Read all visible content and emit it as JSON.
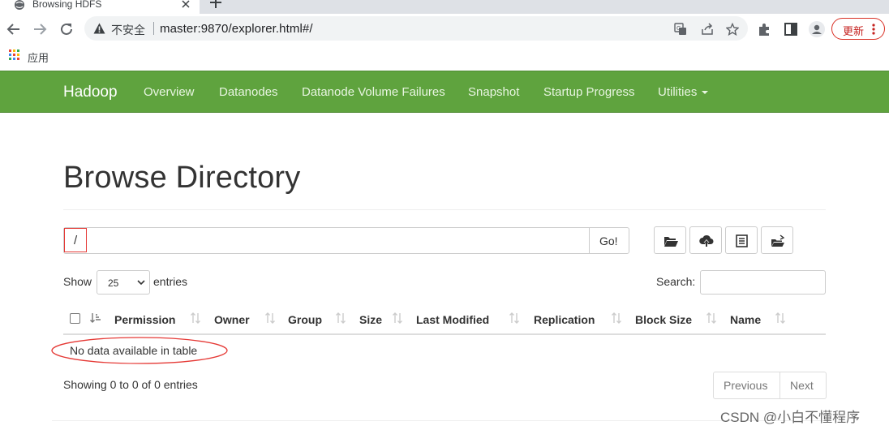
{
  "browser": {
    "tab_title": "Browsing HDFS",
    "insecure_label": "不安全",
    "url": "master:9870/explorer.html#/",
    "update_label": "更新",
    "bookmarks_apps_label": "应用",
    "icons": [
      "back-icon",
      "forward-icon",
      "reload-icon",
      "warning-icon",
      "translate-icon",
      "share-icon",
      "star-icon",
      "extensions-icon",
      "sidebar-icon",
      "profile-icon",
      "more-icon",
      "apps-icon"
    ]
  },
  "navbar": {
    "brand": "Hadoop",
    "items": [
      {
        "label": "Overview"
      },
      {
        "label": "Datanodes"
      },
      {
        "label": "Datanode Volume Failures"
      },
      {
        "label": "Snapshot"
      },
      {
        "label": "Startup Progress"
      },
      {
        "label": "Utilities"
      }
    ],
    "color": "#5fa33e"
  },
  "main": {
    "title": "Browse Directory",
    "path_value": "/",
    "go_label": "Go!",
    "action_icons": [
      "folder-open-icon",
      "upload-icon",
      "list-icon",
      "cut-paste-icon"
    ],
    "show_label": "Show",
    "entries_value": "25",
    "entries_label": "entries",
    "search_label": "Search:",
    "table": {
      "columns": [
        "Permission",
        "Owner",
        "Group",
        "Size",
        "Last Modified",
        "Replication",
        "Block Size",
        "Name"
      ],
      "empty_message": "No data available in table"
    },
    "info_text": "Showing 0 to 0 of 0 entries",
    "pagination": {
      "previous": "Previous",
      "next": "Next"
    }
  },
  "watermark": "CSDN @小白不懂程序",
  "annotation_color": "#e53935"
}
